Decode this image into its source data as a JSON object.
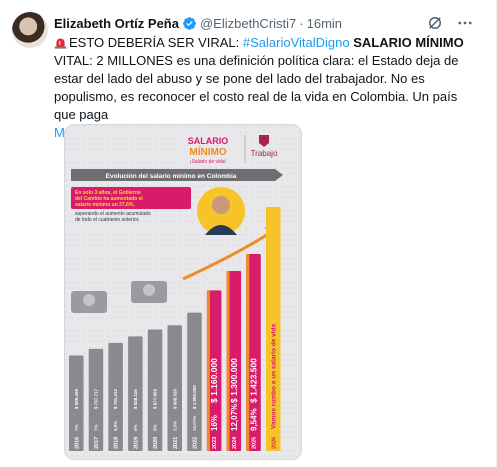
{
  "tweet": {
    "author_name": "Elizabeth Ortíz Peña",
    "handle": "@ElizbethCristi7",
    "separator": "·",
    "time": "16min",
    "text": {
      "lead": "ESTO DEBERÍA SER VIRAL: ",
      "hashtag": "#SalarioVitalDigno",
      "bold": " SALARIO MÍNIMO",
      "rest": " VITAL: 2 MILLONES es una definición política clara: el Estado deja de estar del lado del abuso y se pone del lado del trabajador. No es populismo, es reconocer el costo real de la vida en Colombia. Un país que paga"
    },
    "show_more": "Mostrar más"
  },
  "infographic": {
    "logo_line1": "SALARIO",
    "logo_line2": "MÍNIMO",
    "logo_sub": "¡Salario de vida!",
    "ministry": "Trabajo",
    "banner": "Evolución del salario mínimo en Colombia",
    "callout_line1": "En solo 3 años, el Gobierno",
    "callout_line2": "del Cambio ha aumentado el",
    "callout_line3": "salario mínimo un 37,6%,",
    "callout_line4": "superando el aumento acumulado",
    "callout_line5": "de todo el cuatrienio anterior.",
    "final_label": "2026 Vamos rumbo a un salario de vida",
    "colors": {
      "gray_bar": "#8a8a8e",
      "orange": "#f08a24",
      "magenta": "#d81b6a",
      "yellow": "#f6c428",
      "background": "#e8e8ea"
    }
  },
  "chart_data": {
    "type": "bar",
    "title": "Evolución del salario mínimo en Colombia",
    "categories": [
      "2016",
      "2017",
      "2018",
      "2019",
      "2020",
      "2021",
      "2022",
      "2023",
      "2024",
      "2025",
      "2026"
    ],
    "values": [
      689455,
      737717,
      781242,
      828116,
      877803,
      908526,
      1000000,
      1160000,
      1300000,
      1423500,
      null
    ],
    "value_labels": [
      "$ 689.455",
      "$ 737.717",
      "$ 781.242",
      "$ 828.116",
      "$ 877.803",
      "$ 908.526",
      "$ 1.000.000",
      "$ 1.160.000",
      "$ 1.300.000",
      "$ 1.423.500",
      ""
    ],
    "increase_labels": [
      "7%",
      "7%",
      "5,9%",
      "6%",
      "6%",
      "3,5%",
      "10,07%",
      "16%",
      "12,07%",
      "9,54%",
      ""
    ],
    "ylim": [
      0,
      1600000
    ]
  }
}
